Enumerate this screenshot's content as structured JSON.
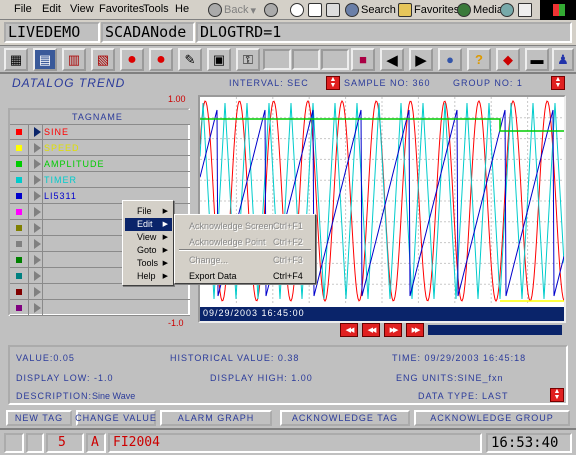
{
  "browser": {
    "menu": [
      "File",
      "Edit",
      "View",
      "Favorites",
      "Tools",
      "Help"
    ],
    "back": "Back",
    "search": "Search",
    "favorites": "Favorites",
    "media": "Media"
  },
  "titles": [
    "LIVEDEMO",
    "SCADANode",
    "DLOGTRD=1"
  ],
  "header": {
    "title": "DATALOG TREND",
    "interval": "INTERVAL: SEC",
    "sample": "SAMPLE NO: 360",
    "group": "GROUP NO: 1"
  },
  "scale": {
    "max": "1.00",
    "min": "-1.0"
  },
  "taglist": {
    "header": "TAGNAME",
    "rows": [
      {
        "name": "SINE",
        "color": "#ff0000",
        "active": true
      },
      {
        "name": "SPEED",
        "color": "#ffff00"
      },
      {
        "name": "AMPLITUDE",
        "color": "#00cc00"
      },
      {
        "name": "TIMER",
        "color": "#00cccc"
      },
      {
        "name": "LI5311",
        "color": "#0000cc"
      },
      {
        "name": "",
        "color": "#ff00ff"
      },
      {
        "name": "",
        "color": "#808000"
      },
      {
        "name": "",
        "color": "#808080"
      },
      {
        "name": "",
        "color": "#008000"
      },
      {
        "name": "",
        "color": "#008080"
      },
      {
        "name": "",
        "color": "#800000"
      },
      {
        "name": "",
        "color": "#800080"
      }
    ]
  },
  "context_menu": {
    "items": [
      "File",
      "Edit",
      "View",
      "Goto",
      "Tools",
      "Help"
    ],
    "selected": "Edit"
  },
  "submenu": [
    {
      "label": "Acknowledge Screen",
      "shortcut": "Ctrl+F1",
      "disabled": true
    },
    {
      "label": "Acknowledge Point",
      "shortcut": "Ctrl+F2",
      "disabled": true
    },
    {
      "label": "Change...",
      "shortcut": "Ctrl+F3",
      "disabled": true
    },
    {
      "label": "Export Data",
      "shortcut": "Ctrl+F4",
      "disabled": false
    }
  ],
  "chart": {
    "timestamp": "09/29/2003 16:45:00",
    "colors": {
      "sine": "#ff0000",
      "amplitude": "#00cc00",
      "timer": "#00cccc",
      "li5311": "#0000cc",
      "speed": "#ffff00"
    }
  },
  "info": {
    "value": "VALUE:0.05",
    "historical": "HISTORICAL VALUE: 0.38",
    "time": "TIME: 09/29/2003 16:45:18",
    "display_low": "DISPLAY LOW: -1.0",
    "display_high": "DISPLAY HIGH: 1.00",
    "eng_units": "ENG UNITS:SINE_fxn",
    "description_label": "DESCRIPTION:",
    "description": "Sine Wave",
    "data_type": "DATA TYPE: LAST"
  },
  "buttons": [
    "NEW TAG",
    "CHANGE VALUE",
    "ALARM GRAPH",
    "ACKNOWLEDGE TAG",
    "ACKNOWLEDGE GROUP"
  ],
  "status": {
    "count": "5",
    "flag": "A",
    "tag": "FI2004",
    "clock": "16:53:40"
  }
}
